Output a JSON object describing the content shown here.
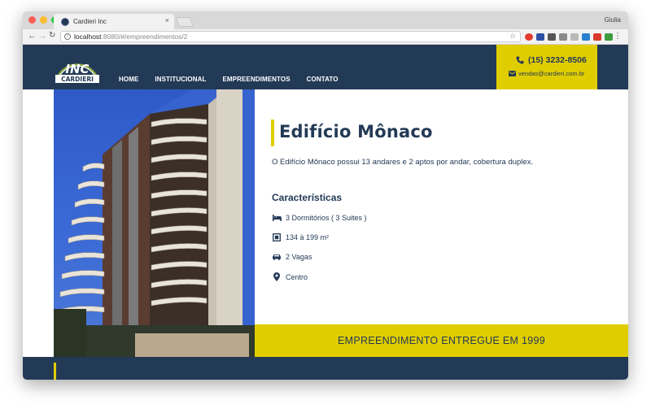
{
  "browser": {
    "tab_title": "Cardieri Inc",
    "tab_close": "×",
    "profile_name": "Giulia",
    "url_host": "localhost",
    "url_rest": ":8080/#/empreendimentos/2"
  },
  "header": {
    "logo_top": "INC",
    "logo_bottom": "CARDIERI",
    "nav": [
      "HOME",
      "INSTITUCIONAL",
      "EMPREENDIMENTOS",
      "CONTATO"
    ],
    "phone": "(15) 3232-8506",
    "email": "vendas@cardieri.com.br"
  },
  "property": {
    "title": "Edifício Mônaco",
    "description": "O Edifício Mônaco possui 13 andares e 2 aptos por andar, cobertura duplex.",
    "characteristics_title": "Características",
    "features": [
      {
        "icon": "bed-icon",
        "text": "3 Dormitórios ( 3 Suites )"
      },
      {
        "icon": "area-icon",
        "text": "134 à 199 m²"
      },
      {
        "icon": "car-icon",
        "text": "2 Vagas"
      },
      {
        "icon": "map-marker-icon",
        "text": "Centro"
      }
    ],
    "delivered": "EMPREENDIMENTO ENTREGUE EM 1999"
  },
  "colors": {
    "navy": "#233a56",
    "yellow": "#e0cd00"
  }
}
